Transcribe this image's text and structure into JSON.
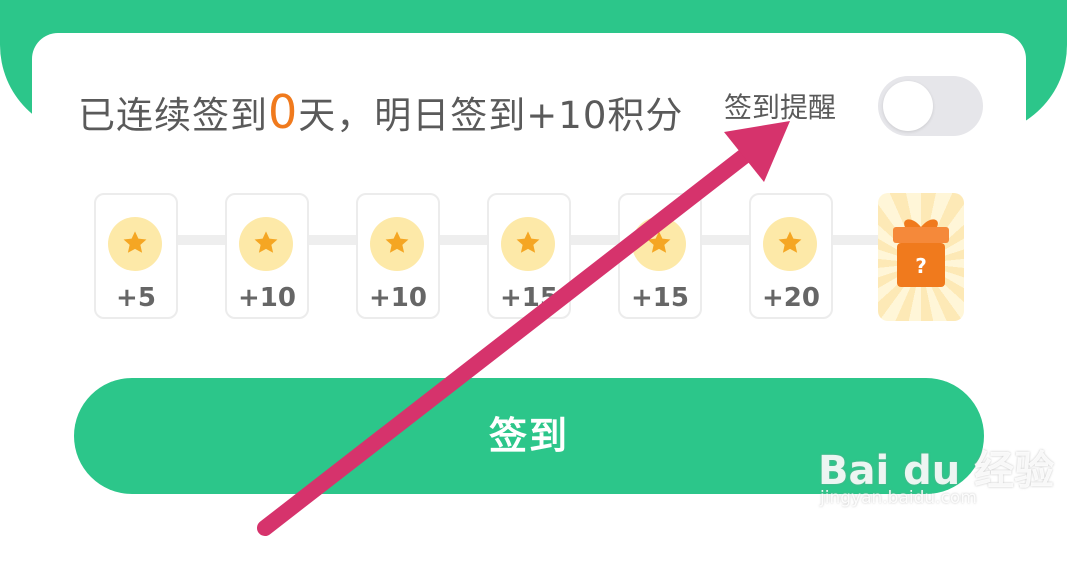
{
  "header": {
    "streak_prefix": "已连续签到",
    "streak_days": "0",
    "streak_suffix": "天，明日签到+10积分",
    "reminder_label": "签到提醒",
    "reminder_enabled": false
  },
  "days": [
    {
      "points": "+5",
      "icon": "star-coin-icon"
    },
    {
      "points": "+10",
      "icon": "star-coin-icon"
    },
    {
      "points": "+10",
      "icon": "star-coin-icon"
    },
    {
      "points": "+15",
      "icon": "star-coin-icon"
    },
    {
      "points": "+15",
      "icon": "star-coin-icon"
    },
    {
      "points": "+20",
      "icon": "star-coin-icon"
    }
  ],
  "gift": {
    "icon": "mystery-gift-icon",
    "mark": "?"
  },
  "checkin_button": {
    "label": "签到"
  },
  "colors": {
    "brand_green": "#2cc68a",
    "streak_orange": "#f07a1d",
    "annotation_arrow": "#d6336c",
    "coin_fill": "#fde9a8",
    "star": "#f5a623",
    "gift_orange": "#f07a1d"
  },
  "watermark": {
    "brand": "Bai du 经验",
    "url": "jingyan.baidu.com"
  }
}
